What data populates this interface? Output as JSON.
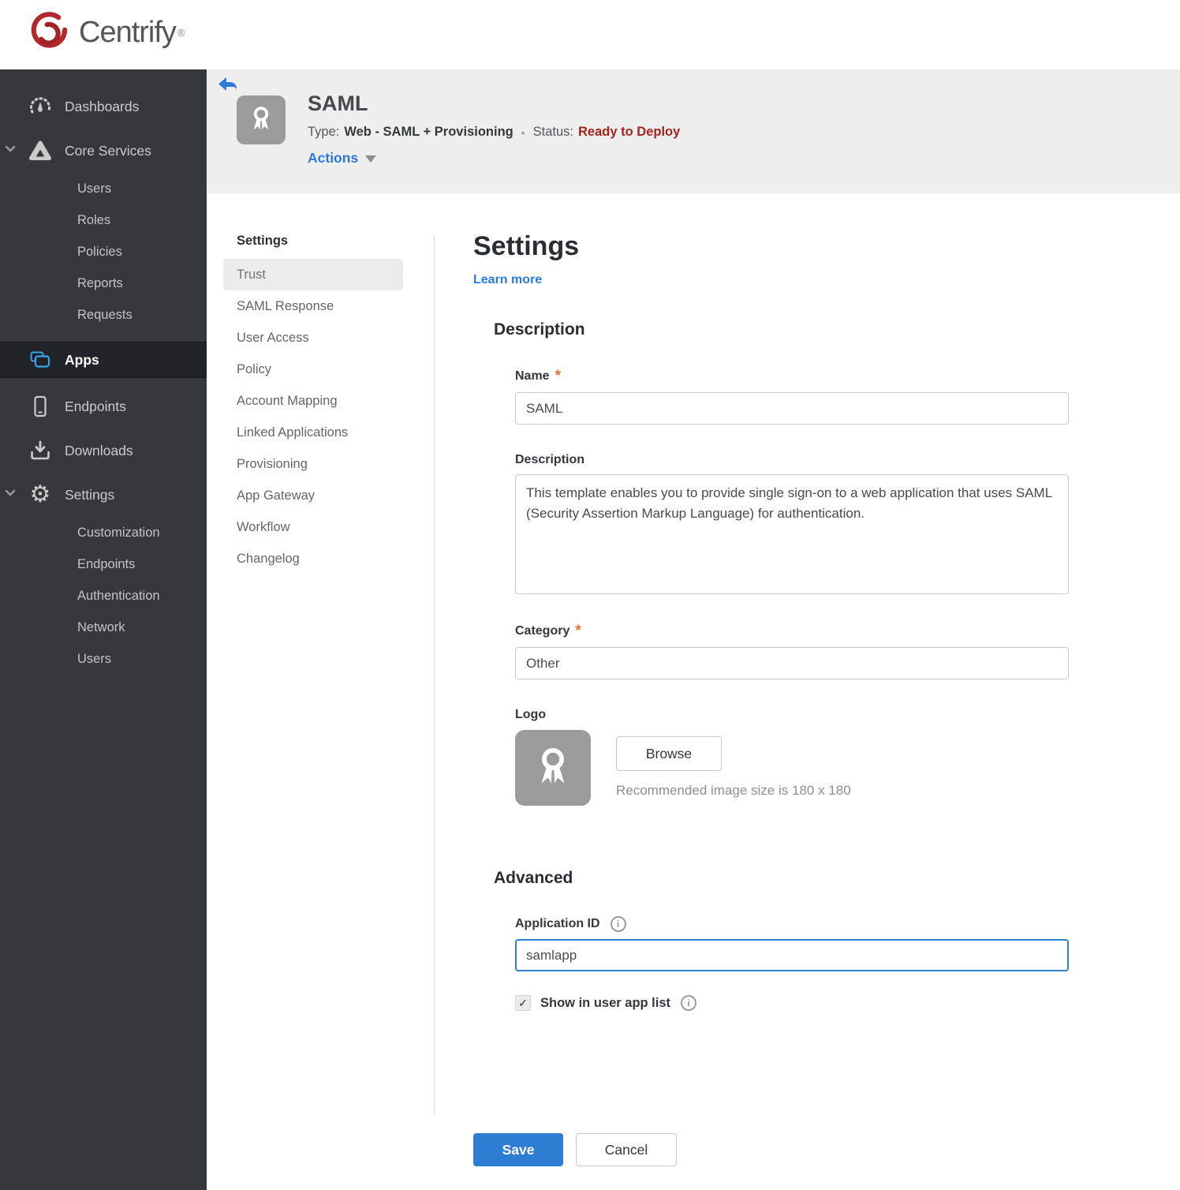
{
  "ui": {
    "required_marker": "*",
    "info_glyph": "i",
    "check_glyph": "✓",
    "gear_glyph": "⚙",
    "separator": "•",
    "accent_blue": "#2d7dd2",
    "status_red": "#a3231d",
    "sidebar_bg": "#35383c",
    "icon_blue": "#3aa3ea",
    "brand_red": "#b3282c"
  },
  "brand": {
    "name": "Centrify",
    "registered": "®"
  },
  "sidebar": {
    "dashboards": "Dashboards",
    "core_services": "Core Services",
    "core_children": [
      "Users",
      "Roles",
      "Policies",
      "Reports",
      "Requests"
    ],
    "apps": "Apps",
    "endpoints": "Endpoints",
    "downloads": "Downloads",
    "settings": "Settings",
    "settings_children": [
      "Customization",
      "Endpoints",
      "Authentication",
      "Network",
      "Users"
    ]
  },
  "header": {
    "app_name": "SAML",
    "type_label": "Type:",
    "type_value": "Web - SAML + Provisioning",
    "status_label": "Status:",
    "status_value": "Ready to Deploy",
    "actions_label": "Actions"
  },
  "subnav": {
    "heading": "Settings",
    "items": [
      "Trust",
      "SAML Response",
      "User Access",
      "Policy",
      "Account Mapping",
      "Linked Applications",
      "Provisioning",
      "App Gateway",
      "Workflow",
      "Changelog"
    ],
    "active_item": "Trust"
  },
  "main": {
    "title": "Settings",
    "learn_more_label": "Learn more",
    "description": {
      "heading": "Description",
      "name_label": "Name",
      "name_value": "SAML",
      "desc_label": "Description",
      "desc_value": "This template enables you to provide single sign-on to a web application that uses SAML (Security Assertion Markup Language) for authentication.",
      "category_label": "Category",
      "category_value": "Other",
      "logo_label": "Logo",
      "browse_label": "Browse",
      "logo_hint": "Recommended image size is 180 x 180"
    },
    "advanced": {
      "heading": "Advanced",
      "app_id_label": "Application ID",
      "app_id_value": "samlapp",
      "show_label": "Show in user app list",
      "checked": true
    },
    "save_label": "Save",
    "cancel_label": "Cancel"
  }
}
